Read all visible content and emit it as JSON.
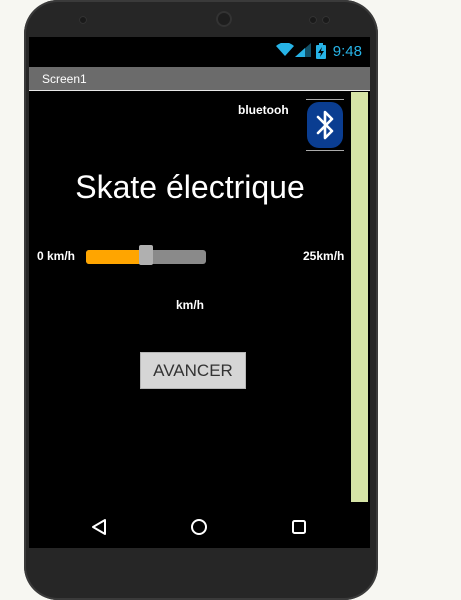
{
  "status_bar": {
    "time": "9:48"
  },
  "title_bar": {
    "title": "Screen1"
  },
  "app": {
    "bluetooth_label": "bluetooh",
    "title": "Skate électrique",
    "speed_min_label": "0 km/h",
    "speed_max_label": "25km/h",
    "slider_level": 0.5,
    "speed_value_label": "km/h",
    "go_button_label": "AVANCER"
  },
  "icons": {
    "wifi": "wifi-icon",
    "signal": "signal-icon",
    "battery": "battery-charging-icon",
    "bluetooth": "bluetooth-icon",
    "back": "back-icon",
    "home": "home-icon",
    "recents": "recents-icon"
  },
  "colors": {
    "accent_status": "#27b3e6",
    "slider_fill": "#ffa500",
    "side_bar": "#d6e4a6",
    "bluetooth_bg": "#0a3d91"
  }
}
